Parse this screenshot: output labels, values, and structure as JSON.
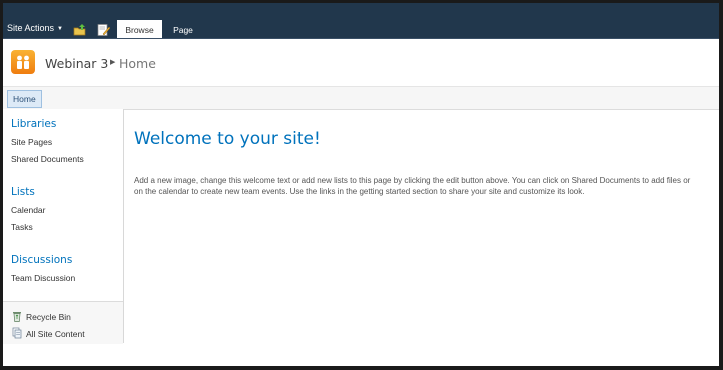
{
  "ribbon": {
    "site_actions_label": "Site Actions",
    "tabs": [
      {
        "label": "Browse",
        "selected": true
      },
      {
        "label": "Page",
        "selected": false
      }
    ],
    "background": "#21374c"
  },
  "header": {
    "site_title": "Webinar 3",
    "current_page": "Home",
    "logo_colors": [
      "#f9b233",
      "#ef7d0f"
    ]
  },
  "topnav": {
    "items": [
      {
        "label": "Home",
        "selected": true
      }
    ]
  },
  "quicklaunch": {
    "sections": [
      {
        "heading": "Libraries",
        "items": [
          "Site Pages",
          "Shared Documents"
        ]
      },
      {
        "heading": "Lists",
        "items": [
          "Calendar",
          "Tasks"
        ]
      },
      {
        "heading": "Discussions",
        "items": [
          "Team Discussion"
        ]
      }
    ],
    "utility": [
      {
        "label": "Recycle Bin",
        "icon": "recycle-bin-icon"
      },
      {
        "label": "All Site Content",
        "icon": "all-site-content-icon"
      }
    ]
  },
  "main": {
    "heading": "Welcome to your site!",
    "body": "Add a new image, change this welcome text or add new lists to this page by clicking the edit button above. You can click on Shared Documents to add files or on the calendar to create new team events. Use the links in the getting started section to share your site and customize its look."
  },
  "colors": {
    "accent": "#0072bc",
    "text": "#333333"
  }
}
